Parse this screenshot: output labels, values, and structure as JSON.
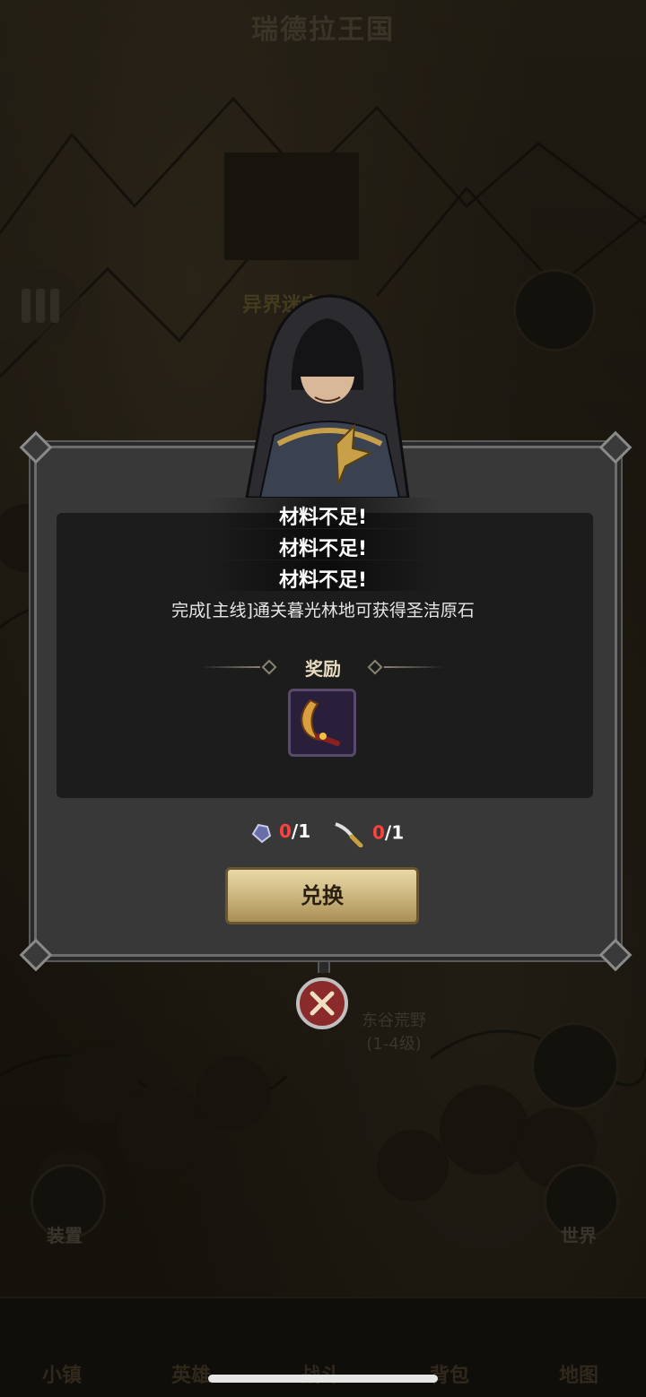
{
  "map": {
    "title": "瑞德拉王国",
    "location_top": "异界迷宫",
    "location_bottom_name": "东谷荒野",
    "location_bottom_level": "(1-4级)",
    "left_side_label": "装置",
    "right_side_label": "世界"
  },
  "bottom_nav": {
    "items": [
      {
        "label": "小镇"
      },
      {
        "label": "英雄"
      },
      {
        "label": "战斗"
      },
      {
        "label": "背包"
      },
      {
        "label": "地图"
      }
    ]
  },
  "dialog": {
    "messages": [
      "材料不足!",
      "材料不足!",
      "材料不足!"
    ],
    "description": "完成[主线]通关暮光林地可获得圣洁原石",
    "reward_label": "奖励",
    "reward_item_icon": "golden-scimitar-icon",
    "costs": [
      {
        "icon": "crystal-ore-icon",
        "have": "0",
        "need": "/1"
      },
      {
        "icon": "dagger-icon",
        "have": "0",
        "need": "/1"
      }
    ],
    "exchange_button": "兑换"
  },
  "colors": {
    "panel": "#383838",
    "warning_red": "#ff4040",
    "button_gold": "#c9b37a"
  }
}
